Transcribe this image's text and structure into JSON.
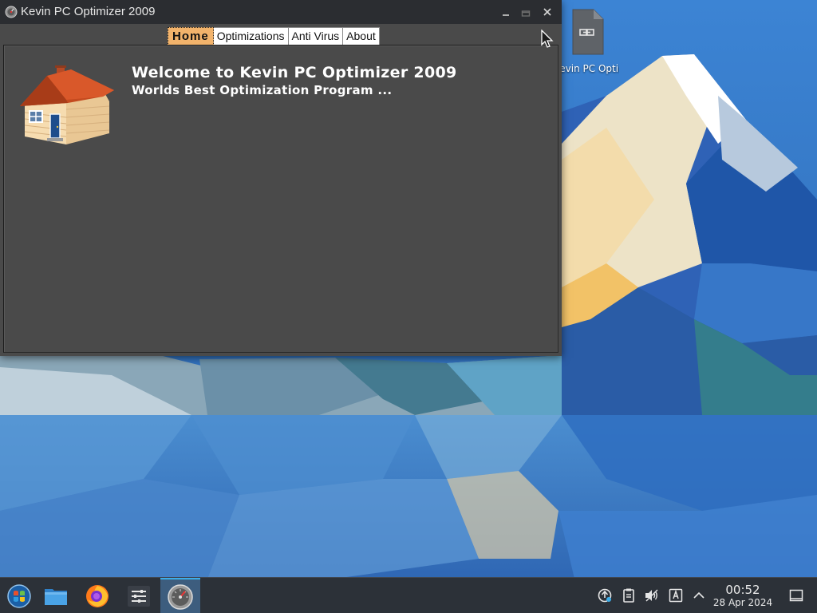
{
  "window": {
    "title": "Kevin PC Optimizer 2009",
    "controls": {
      "minimize": "minimize-icon",
      "maximize": "maximize-icon",
      "close": "close-icon"
    }
  },
  "tabs": [
    {
      "label": "Home",
      "active": true
    },
    {
      "label": "Optimizations",
      "active": false
    },
    {
      "label": "Anti Virus",
      "active": false
    },
    {
      "label": "About",
      "active": false
    }
  ],
  "home": {
    "welcome_title": "Welcome to Kevin PC Optimizer 2009",
    "welcome_subtitle": "Worlds Best Optimization Program ...",
    "illustration": "house-icon"
  },
  "desktop": {
    "icons": [
      {
        "label": "Kevin PC Optimizer Ho…",
        "icon": "shortcut-file-icon"
      }
    ]
  },
  "taskbar": {
    "launchers": [
      {
        "name": "start-menu",
        "icon": "start-orb-icon"
      },
      {
        "name": "file-manager",
        "icon": "folder-icon"
      },
      {
        "name": "firefox",
        "icon": "firefox-icon"
      },
      {
        "name": "system-settings",
        "icon": "settings-sliders-icon"
      },
      {
        "name": "kevin-pc-optimizer",
        "icon": "optimizer-app-icon",
        "active": true
      }
    ],
    "tray": {
      "icons": [
        "updates-icon",
        "clipboard-icon",
        "volume-muted-icon",
        "keyboard-layout-icon",
        "chevron-up-icon"
      ],
      "clock": {
        "time": "00:52",
        "date": "28 Apr 2024"
      },
      "show_desktop_icon": "show-desktop-icon"
    }
  },
  "colors": {
    "titlebar": "#2b2d31",
    "window_body": "#4a4a4a",
    "active_tab": "#f2b36b",
    "taskbar": "#2c3138",
    "taskbar_active": "#3d5d7e",
    "accent": "#3daee9"
  }
}
